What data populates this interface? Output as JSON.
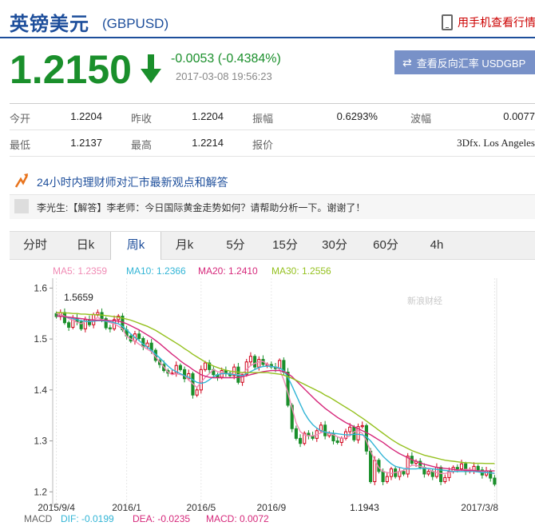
{
  "header": {
    "title": "英镑美元",
    "code": "(GBPUSD)",
    "mobile_link": "用手机查看行情"
  },
  "quote": {
    "price": "1.2150",
    "change": "-0.0053 (-0.4384%)",
    "datetime": "2017-03-08 19:56:23",
    "reverse_button": "查看反向汇率 USDGBP",
    "colors": {
      "down": "#1a8f2b",
      "accent": "#1d4e9b"
    },
    "rows": [
      [
        {
          "label": "今开",
          "value": "1.2204"
        },
        {
          "label": "昨收",
          "value": "1.2204"
        },
        {
          "label": "振幅",
          "value": "0.6293%"
        },
        {
          "label": "波幅",
          "value": "0.0077"
        }
      ],
      [
        {
          "label": "最低",
          "value": "1.2137"
        },
        {
          "label": "最高",
          "value": "1.2214"
        },
        {
          "label": "报价",
          "value": "3Dfx. Los Angeles"
        }
      ]
    ]
  },
  "advice": {
    "headline": "24小时内理财师对汇市最新观点和解答",
    "comment": "李光生:【解答】李老师：今日国际黄金走势如何？请帮助分析一下。谢谢了！"
  },
  "tabs": [
    "分时",
    "日k",
    "周k",
    "月k",
    "5分",
    "15分",
    "30分",
    "60分",
    "4h"
  ],
  "active_tab": "周k",
  "chart_data": {
    "type": "candlestick",
    "watermark": "新浪财经",
    "ma_legend": [
      {
        "label": "MA5: 1.2359",
        "color": "#f08bb5"
      },
      {
        "label": "MA10: 1.2366",
        "color": "#32b5d6"
      },
      {
        "label": "MA20: 1.2410",
        "color": "#d6287b"
      },
      {
        "label": "MA30: 1.2556",
        "color": "#95c11f"
      }
    ],
    "ylim": [
      1.18,
      1.61
    ],
    "yticks": [
      "1.6",
      "1.5",
      "1.4",
      "1.3",
      "1.2"
    ],
    "xticks": [
      "2015/9/4",
      "2016/1",
      "2016/5",
      "2016/9",
      "2017/3/8"
    ],
    "annotations": {
      "high": "1.5659",
      "low": "1.1943"
    },
    "macd_legend": [
      {
        "label": "MACD",
        "color": "#666666"
      },
      {
        "label": "DIF: -0.0199",
        "color": "#32b5d6"
      },
      {
        "label": "DEA: -0.0235",
        "color": "#d6287b"
      },
      {
        "label": "MACD: 0.0072",
        "color": "#d6287b"
      }
    ],
    "close": [
      1.544,
      1.552,
      1.532,
      1.523,
      1.541,
      1.534,
      1.52,
      1.538,
      1.528,
      1.548,
      1.552,
      1.54,
      1.522,
      1.52,
      1.538,
      1.545,
      1.518,
      1.506,
      1.496,
      1.51,
      1.501,
      1.485,
      1.492,
      1.478,
      1.458,
      1.45,
      1.438,
      1.433,
      1.433,
      1.448,
      1.44,
      1.422,
      1.432,
      1.39,
      1.4,
      1.44,
      1.453,
      1.44,
      1.43,
      1.425,
      1.438,
      1.433,
      1.428,
      1.445,
      1.415,
      1.43,
      1.455,
      1.466,
      1.445,
      1.46,
      1.45,
      1.45,
      1.445,
      1.442,
      1.458,
      1.435,
      1.37,
      1.324,
      1.305,
      1.295,
      1.315,
      1.31,
      1.305,
      1.32,
      1.331,
      1.31,
      1.315,
      1.3,
      1.297,
      1.305,
      1.318,
      1.327,
      1.302,
      1.328,
      1.33,
      1.28,
      1.22,
      1.262,
      1.24,
      1.22,
      1.23,
      1.245,
      1.23,
      1.24,
      1.235,
      1.27,
      1.256,
      1.26,
      1.248,
      1.235,
      1.24,
      1.23,
      1.248,
      1.22,
      1.228,
      1.24,
      1.248,
      1.245,
      1.255,
      1.24,
      1.242,
      1.25,
      1.243,
      1.233,
      1.241,
      1.227,
      1.215
    ],
    "ma5": [
      1.55,
      1.548,
      1.545,
      1.54,
      1.537,
      1.533,
      1.53,
      1.535,
      1.534,
      1.538,
      1.542,
      1.538,
      1.535,
      1.532,
      1.53,
      1.525,
      1.52,
      1.505,
      1.5,
      1.496,
      1.49,
      1.485,
      1.48,
      1.475,
      1.465,
      1.455,
      1.445,
      1.435,
      1.43,
      1.432,
      1.43,
      1.428,
      1.42,
      1.412,
      1.405,
      1.415,
      1.425,
      1.432,
      1.44,
      1.436,
      1.434,
      1.432,
      1.432,
      1.43,
      1.43,
      1.432,
      1.44,
      1.448,
      1.452,
      1.455,
      1.456,
      1.45,
      1.446,
      1.445,
      1.44,
      1.42,
      1.395,
      1.365,
      1.335,
      1.318,
      1.312,
      1.31,
      1.31,
      1.312,
      1.316,
      1.318,
      1.315,
      1.312,
      1.308,
      1.305,
      1.306,
      1.31,
      1.318,
      1.32,
      1.315,
      1.3,
      1.28,
      1.262,
      1.248,
      1.24,
      1.238,
      1.236,
      1.238,
      1.24,
      1.242,
      1.248,
      1.252,
      1.252,
      1.25,
      1.248,
      1.245,
      1.24,
      1.238,
      1.236,
      1.236,
      1.238,
      1.24,
      1.242,
      1.243,
      1.244,
      1.244,
      1.242,
      1.24,
      1.24,
      1.238,
      1.237,
      1.236
    ],
    "ma10": [
      1.545,
      1.545,
      1.544,
      1.542,
      1.54,
      1.538,
      1.536,
      1.535,
      1.534,
      1.535,
      1.536,
      1.536,
      1.535,
      1.534,
      1.532,
      1.53,
      1.525,
      1.518,
      1.51,
      1.503,
      1.497,
      1.49,
      1.484,
      1.478,
      1.47,
      1.463,
      1.455,
      1.447,
      1.44,
      1.436,
      1.432,
      1.428,
      1.425,
      1.42,
      1.415,
      1.413,
      1.415,
      1.42,
      1.426,
      1.43,
      1.432,
      1.432,
      1.431,
      1.43,
      1.429,
      1.428,
      1.432,
      1.436,
      1.44,
      1.444,
      1.446,
      1.447,
      1.446,
      1.445,
      1.443,
      1.438,
      1.425,
      1.408,
      1.39,
      1.372,
      1.355,
      1.342,
      1.332,
      1.325,
      1.32,
      1.317,
      1.316,
      1.315,
      1.314,
      1.313,
      1.312,
      1.312,
      1.313,
      1.313,
      1.312,
      1.308,
      1.3,
      1.29,
      1.28,
      1.27,
      1.262,
      1.255,
      1.25,
      1.248,
      1.246,
      1.245,
      1.245,
      1.245,
      1.246,
      1.246,
      1.246,
      1.245,
      1.244,
      1.243,
      1.242,
      1.241,
      1.24,
      1.24,
      1.24,
      1.24,
      1.24,
      1.24,
      1.239,
      1.238,
      1.238,
      1.237,
      1.2366
    ],
    "ma20": [
      1.545,
      1.545,
      1.544,
      1.543,
      1.542,
      1.541,
      1.54,
      1.539,
      1.538,
      1.537,
      1.537,
      1.537,
      1.537,
      1.536,
      1.536,
      1.535,
      1.533,
      1.53,
      1.526,
      1.522,
      1.518,
      1.513,
      1.508,
      1.503,
      1.497,
      1.491,
      1.484,
      1.477,
      1.47,
      1.464,
      1.457,
      1.451,
      1.446,
      1.44,
      1.435,
      1.43,
      1.427,
      1.425,
      1.424,
      1.424,
      1.424,
      1.424,
      1.424,
      1.424,
      1.425,
      1.426,
      1.428,
      1.43,
      1.432,
      1.434,
      1.436,
      1.437,
      1.438,
      1.438,
      1.438,
      1.436,
      1.432,
      1.426,
      1.418,
      1.41,
      1.402,
      1.394,
      1.386,
      1.378,
      1.371,
      1.364,
      1.358,
      1.352,
      1.346,
      1.341,
      1.336,
      1.332,
      1.328,
      1.324,
      1.32,
      1.316,
      1.312,
      1.307,
      1.302,
      1.297,
      1.291,
      1.285,
      1.28,
      1.275,
      1.271,
      1.267,
      1.263,
      1.26,
      1.257,
      1.254,
      1.252,
      1.25,
      1.248,
      1.247,
      1.246,
      1.245,
      1.244,
      1.243,
      1.243,
      1.242,
      1.242,
      1.242,
      1.241,
      1.241,
      1.241,
      1.241,
      1.241
    ],
    "ma30": [
      1.552,
      1.552,
      1.551,
      1.551,
      1.55,
      1.55,
      1.549,
      1.549,
      1.548,
      1.548,
      1.547,
      1.547,
      1.546,
      1.545,
      1.544,
      1.543,
      1.541,
      1.539,
      1.537,
      1.534,
      1.531,
      1.528,
      1.525,
      1.521,
      1.517,
      1.512,
      1.507,
      1.502,
      1.497,
      1.492,
      1.487,
      1.481,
      1.476,
      1.47,
      1.465,
      1.46,
      1.455,
      1.451,
      1.447,
      1.444,
      1.441,
      1.439,
      1.437,
      1.436,
      1.435,
      1.434,
      1.434,
      1.434,
      1.434,
      1.434,
      1.434,
      1.434,
      1.433,
      1.432,
      1.431,
      1.429,
      1.426,
      1.423,
      1.419,
      1.415,
      1.411,
      1.407,
      1.403,
      1.399,
      1.395,
      1.39,
      1.386,
      1.381,
      1.376,
      1.371,
      1.366,
      1.361,
      1.356,
      1.35,
      1.345,
      1.339,
      1.333,
      1.327,
      1.321,
      1.315,
      1.309,
      1.303,
      1.298,
      1.293,
      1.289,
      1.285,
      1.281,
      1.278,
      1.275,
      1.272,
      1.27,
      1.268,
      1.266,
      1.264,
      1.262,
      1.261,
      1.26,
      1.259,
      1.258,
      1.257,
      1.257,
      1.256,
      1.256,
      1.256,
      1.2556,
      1.2556,
      1.2556
    ]
  }
}
